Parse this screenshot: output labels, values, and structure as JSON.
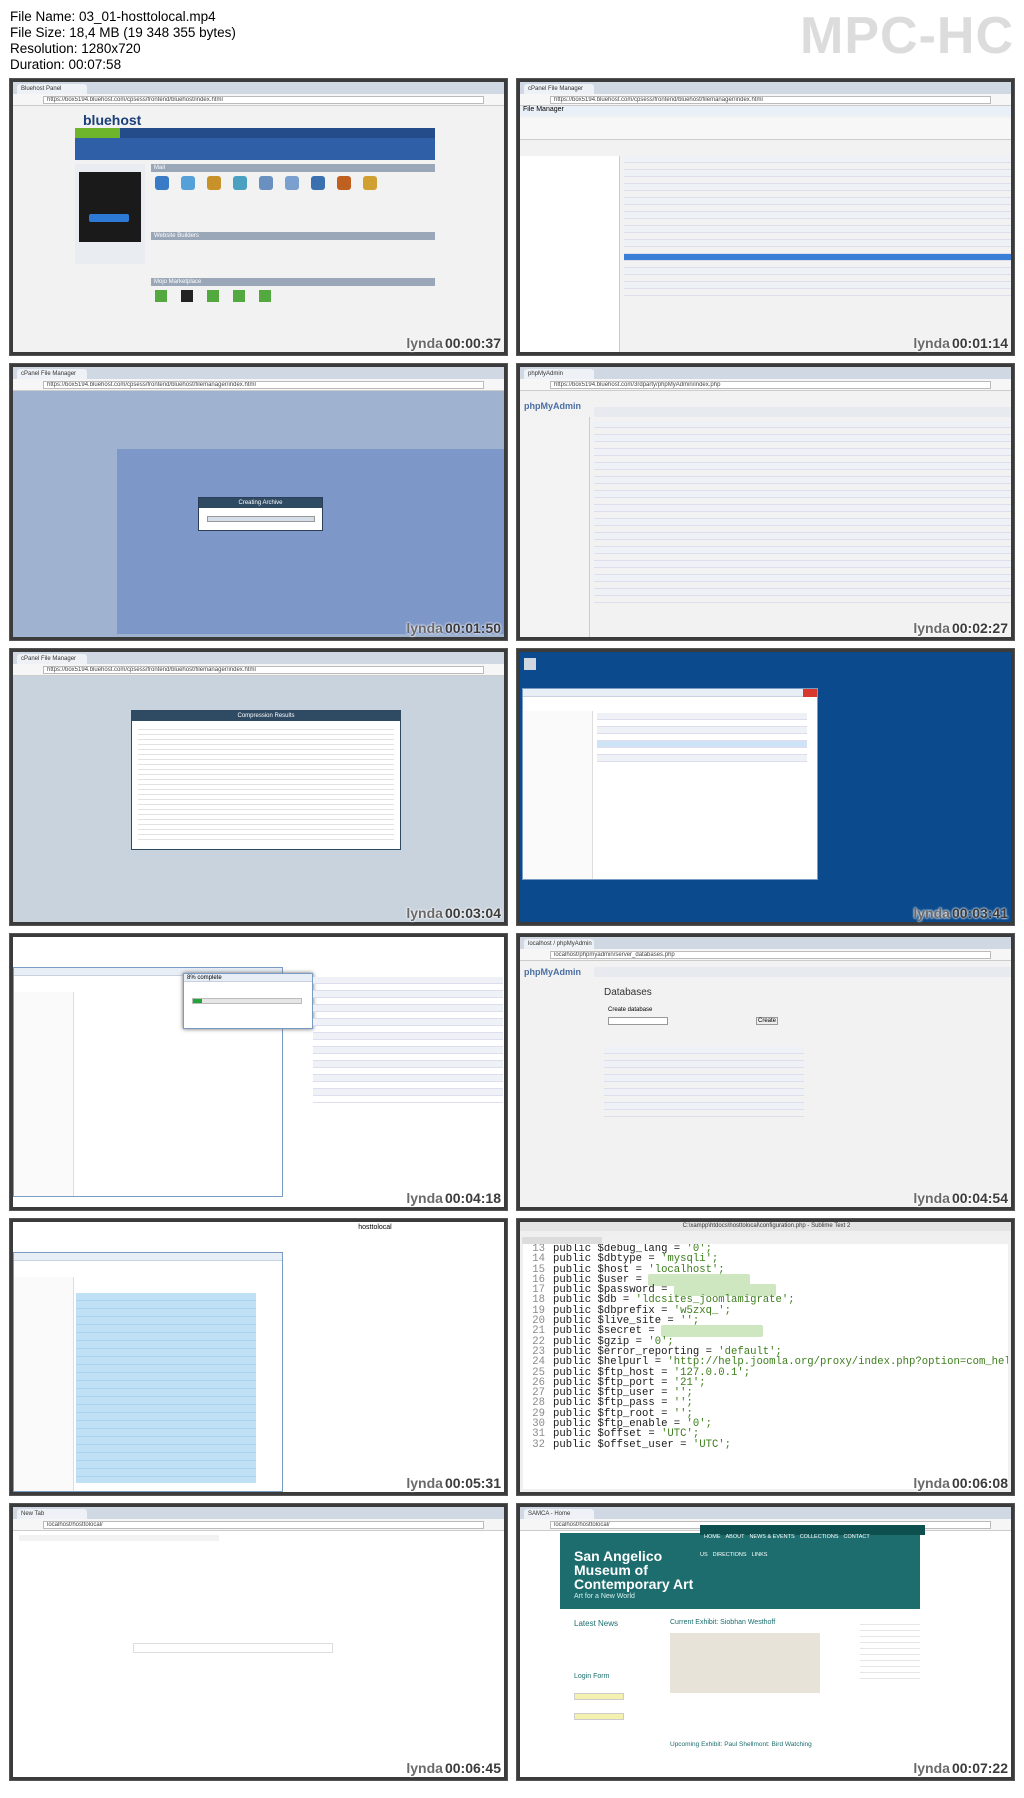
{
  "file_info": {
    "file_name": "File Name: 03_01-hosttolocal.mp4",
    "file_size": "File Size: 18,4 MB (19 348 355 bytes)",
    "resolution": "Resolution: 1280x720",
    "duration": "Duration: 00:07:58"
  },
  "player_logo": "MPC-HC",
  "watermark": "lynda",
  "thumbnails": [
    {
      "time": "00:00:37",
      "scene": "bluehost",
      "caption": "bluehost"
    },
    {
      "time": "00:01:14",
      "scene": "filemanager",
      "caption": "File Manager"
    },
    {
      "time": "00:01:50",
      "scene": "filemanager-archive",
      "caption": "Creating Archive"
    },
    {
      "time": "00:02:27",
      "scene": "phpmyadmin",
      "caption": "phpMyAdmin"
    },
    {
      "time": "00:03:04",
      "scene": "compression",
      "caption": "Compression Results"
    },
    {
      "time": "00:03:41",
      "scene": "explorer-desktop",
      "caption": ""
    },
    {
      "time": "00:04:18",
      "scene": "explorer-copy",
      "caption": "8% complete"
    },
    {
      "time": "00:04:54",
      "scene": "phpmyadmin-db",
      "caption": "Databases"
    },
    {
      "time": "00:05:31",
      "scene": "explorer-folders",
      "caption": "hosttolocal"
    },
    {
      "time": "00:06:08",
      "scene": "sublime",
      "caption": ""
    },
    {
      "time": "00:06:45",
      "scene": "blank-browser",
      "caption": ""
    },
    {
      "time": "00:07:22",
      "scene": "museum",
      "caption": ""
    }
  ],
  "code": {
    "lines": [
      {
        "n": "13",
        "pre": "public $debug_lang = ",
        "val": "'0';"
      },
      {
        "n": "14",
        "pre": "public $dbtype = ",
        "val": "'mysqli';"
      },
      {
        "n": "15",
        "pre": "public $host = ",
        "val": "'localhost';"
      },
      {
        "n": "16",
        "pre": "public $user = ",
        "val": "",
        "blur": true
      },
      {
        "n": "17",
        "pre": "public $password = ",
        "val": "",
        "blur": true
      },
      {
        "n": "18",
        "pre": "public $db = ",
        "val": "'ldcsites_joomlamigrate';"
      },
      {
        "n": "19",
        "pre": "public $dbprefix = ",
        "val": "'w5zxq_';"
      },
      {
        "n": "20",
        "pre": "public $live_site = ",
        "val": "'';"
      },
      {
        "n": "21",
        "pre": "public $secret = ",
        "val": "",
        "blur": true
      },
      {
        "n": "22",
        "pre": "public $gzip = ",
        "val": "'0';"
      },
      {
        "n": "23",
        "pre": "public $error_reporting = ",
        "val": "'default';"
      },
      {
        "n": "24",
        "pre": "public $helpurl = ",
        "val": "'http://help.joomla.org/proxy/index.php?option=com_help&ke"
      },
      {
        "n": "25",
        "pre": "public $ftp_host = ",
        "val": "'127.0.0.1';"
      },
      {
        "n": "26",
        "pre": "public $ftp_port = ",
        "val": "'21';"
      },
      {
        "n": "27",
        "pre": "public $ftp_user = ",
        "val": "'';"
      },
      {
        "n": "28",
        "pre": "public $ftp_pass = ",
        "val": "'';"
      },
      {
        "n": "29",
        "pre": "public $ftp_root = ",
        "val": "'';"
      },
      {
        "n": "30",
        "pre": "public $ftp_enable = ",
        "val": "'0';"
      },
      {
        "n": "31",
        "pre": "public $offset = ",
        "val": "'UTC';"
      },
      {
        "n": "32",
        "pre": "public $offset_user = ",
        "val": "'UTC';"
      }
    ]
  },
  "museum": {
    "title_line1": "San Angelico",
    "title_line2": "Museum of",
    "title_line3": "Contemporary Art",
    "tagline": "Art for a New World",
    "nav": [
      "HOME",
      "ABOUT",
      "NEWS & EVENTS",
      "COLLECTIONS",
      "CONTACT US",
      "DIRECTIONS",
      "LINKS"
    ],
    "latest_news": "Latest News",
    "current_exhibit": "Current Exhibit: Siobhan Westhoff",
    "upcoming": "Upcoming Exhibit: Paul Shellmont: Bird Watching",
    "login": "Login Form"
  },
  "dialogs": {
    "creating_archive": "Creating Archive",
    "compression": "Compression Results",
    "copy_progress": "8% complete",
    "databases": "Databases",
    "create_database": "Create database",
    "create_btn": "Create"
  }
}
